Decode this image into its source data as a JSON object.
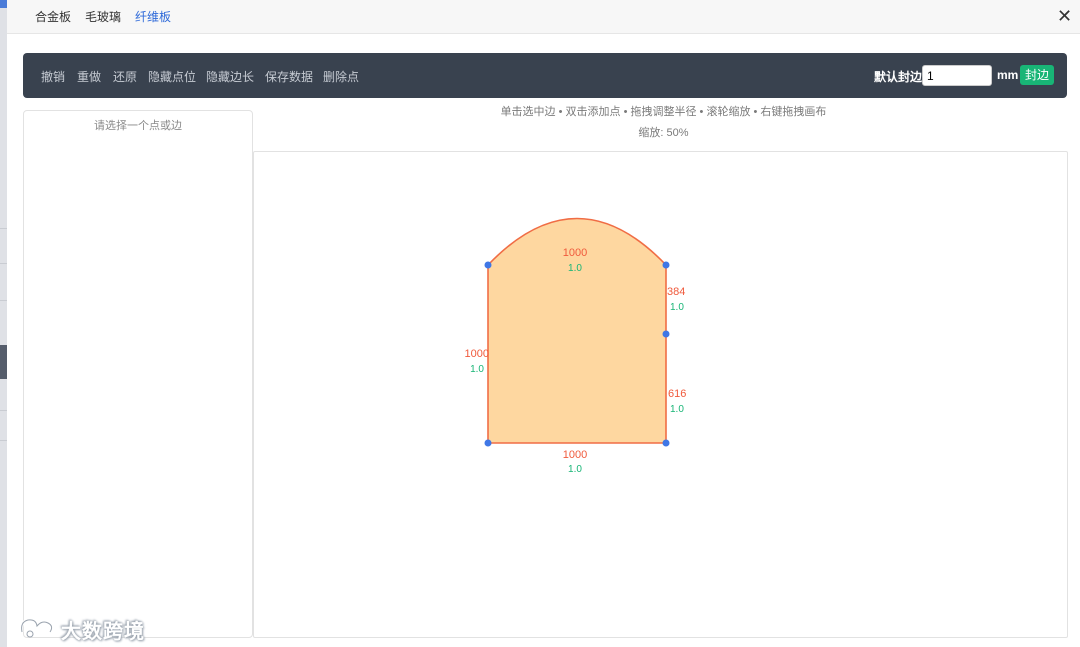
{
  "tabs": [
    {
      "label": "合金板",
      "active": false
    },
    {
      "label": "毛玻璃",
      "active": false
    },
    {
      "label": "纤维板",
      "active": true
    }
  ],
  "close_icon": "✕",
  "toolbar": {
    "undo": "撤销",
    "redo": "重做",
    "restore": "还原",
    "hide_points": "隐藏点位",
    "hide_edge_length": "隐藏边长",
    "save_data": "保存数据",
    "delete_point": "删除点",
    "default_edge_label": "默认封边:",
    "default_edge_value": "1",
    "unit": "mm",
    "apply_button": "封边"
  },
  "left_panel": {
    "hint": "请选择一个点或边"
  },
  "canvas_hint": "单击选中边 • 双击添加点 • 拖拽调整半径 • 滚轮缩放 • 右键拖拽画布",
  "zoom_text": "缩放: 50%",
  "shape": {
    "fill_color": "#fed7a0",
    "stroke_color": "#f06d45",
    "point_color": "#3f77e6",
    "length_color": "#f05a3c",
    "edging_color": "#18b576",
    "edges": [
      {
        "id": "top-arc",
        "length": "1000",
        "edging": "1.0"
      },
      {
        "id": "right-upper",
        "length": "384",
        "edging": "1.0"
      },
      {
        "id": "right-lower",
        "length": "616",
        "edging": "1.0"
      },
      {
        "id": "bottom",
        "length": "1000",
        "edging": "1.0"
      },
      {
        "id": "left",
        "length": "1000",
        "edging": "1.0"
      }
    ]
  },
  "watermark": {
    "text": "大数跨境"
  }
}
